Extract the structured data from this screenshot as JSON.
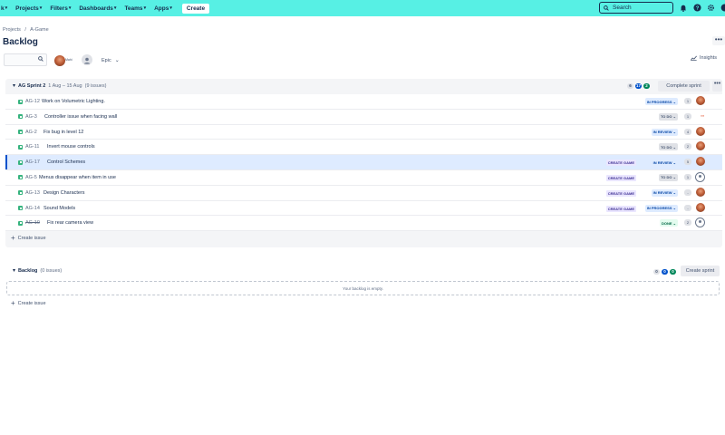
{
  "nav": {
    "partial_item": "k",
    "items": [
      "Projects",
      "Filters",
      "Dashboards",
      "Teams",
      "Apps"
    ],
    "create_label": "Create",
    "search_placeholder": "Search"
  },
  "breadcrumb": {
    "projects": "Projects",
    "separator": "/",
    "project": "A-Game"
  },
  "page_title": "Backlog",
  "toolbar": {
    "epic_label": "Epic",
    "insights_label": "Insights",
    "avatar_tag": "Mahi"
  },
  "sprint": {
    "name": "AG Sprint 2",
    "dates": "1 Aug – 15 Aug",
    "issue_count": "(9 issues)",
    "counts": {
      "todo": "6",
      "inprogress": "17",
      "done": "2"
    },
    "complete_label": "Complete sprint",
    "more_label": "•••",
    "create_issue_label": "Create issue",
    "issues": [
      {
        "key": "AG-12",
        "summary": "Work on Volumetric Lighting.",
        "epic": "",
        "status": "IN PROGRESS",
        "status_type": "inprogress",
        "estimate": "1",
        "assignee": "avatar"
      },
      {
        "key": "AG-3",
        "summary": "Controller issue when facing wall",
        "epic": "",
        "status": "TO DO",
        "status_type": "todo",
        "estimate": "1",
        "assignee": "logo"
      },
      {
        "key": "AG-2",
        "summary": "Fix bug in level 12",
        "epic": "",
        "status": "IN REVIEW",
        "status_type": "review",
        "estimate": "4",
        "assignee": "avatar"
      },
      {
        "key": "AG-11",
        "summary": "Invert mouse controls",
        "epic": "",
        "status": "TO DO",
        "status_type": "todo",
        "estimate": "2",
        "assignee": "avatar"
      },
      {
        "key": "AG-17",
        "summary": "Control Schemes",
        "epic": "CREATE GAME",
        "status": "IN REVIEW",
        "status_type": "review",
        "estimate": "5",
        "assignee": "avatar"
      },
      {
        "key": "AG-5",
        "summary": "Menus disappear when item in use",
        "epic": "CREATE GAME",
        "status": "TO DO",
        "status_type": "todo",
        "estimate": "1",
        "assignee": "empty"
      },
      {
        "key": "AG-13",
        "summary": "Design Characters",
        "epic": "CREATE GAME",
        "status": "IN REVIEW",
        "status_type": "review",
        "estimate": "-",
        "assignee": "avatar"
      },
      {
        "key": "AG-14",
        "summary": "Sound Models",
        "epic": "CREATE GAME",
        "status": "IN PROGRESS",
        "status_type": "inprogress",
        "estimate": "-",
        "assignee": "avatar"
      },
      {
        "key": "AG-10",
        "summary": "Fix rear camera view",
        "epic": "",
        "status": "DONE",
        "status_type": "done",
        "estimate": "2",
        "assignee": "empty"
      }
    ]
  },
  "backlog": {
    "name": "Backlog",
    "issue_count": "(0 issues)",
    "counts": {
      "todo": "0",
      "inprogress": "0",
      "done": "0"
    },
    "create_sprint_label": "Create sprint",
    "empty_text": "Your backlog is empty.",
    "create_issue_label": "Create issue"
  },
  "colors": {
    "nav_bg": "#57f0e4",
    "todo": "#6b778c",
    "inprogress": "#0052cc",
    "done": "#00875a"
  }
}
